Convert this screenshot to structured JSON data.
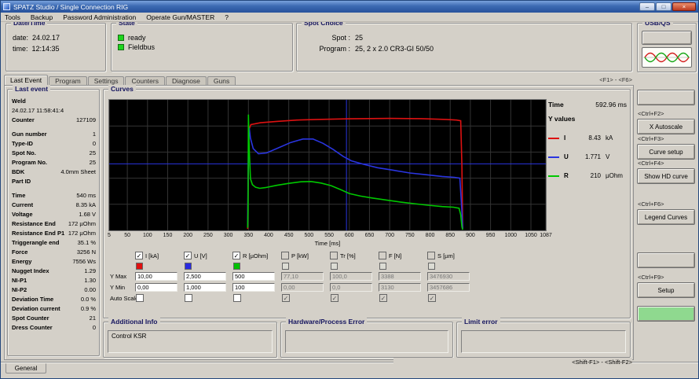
{
  "window": {
    "title": "SPATZ Studio / Single Connection RIG",
    "controls": {
      "minimize": "–",
      "maximize": "□",
      "close": "×"
    }
  },
  "menu": {
    "items": [
      "Tools",
      "Backup",
      "Password Administration",
      "Operate Gun/MASTER",
      "?"
    ]
  },
  "panels": {
    "datetime": {
      "title": "Date/Time",
      "date_label": "date:",
      "date_value": "24.02.17",
      "time_label": "time:",
      "time_value": "12:14:35"
    },
    "state": {
      "title": "State",
      "items": [
        "ready",
        "Fieldbus"
      ]
    },
    "spot": {
      "title": "Spot Choice",
      "spot_label": "Spot :",
      "spot_value": "25",
      "program_label": "Program :",
      "program_value": "25, 2 x 2.0 CR3-GI 50/50"
    },
    "usbqs": {
      "title": "USB/QS"
    }
  },
  "tabs": {
    "items": [
      "Last Event",
      "Program",
      "Settings",
      "Counters",
      "Diagnose",
      "Guns"
    ],
    "active": "Last Event",
    "hint": "<F1> - <F6>"
  },
  "last_event": {
    "title": "Last event",
    "rows": [
      {
        "l": "Weld",
        "v": ""
      },
      {
        "l": "24.02.17  11:58:41:4",
        "v": "",
        "p": true
      },
      {
        "l": "Counter",
        "v": "127109"
      },
      {
        "l": "",
        "v": ""
      },
      {
        "l": "Gun number",
        "v": "1"
      },
      {
        "l": "Type-ID",
        "v": "0"
      },
      {
        "l": "Spot No.",
        "v": "25"
      },
      {
        "l": "Program No.",
        "v": "25"
      },
      {
        "l": "BDK",
        "v": "4.0mm Sheet"
      },
      {
        "l": "Part ID",
        "v": ""
      },
      {
        "l": "",
        "v": ""
      },
      {
        "l": "Time",
        "v": "540 ms"
      },
      {
        "l": "Current",
        "v": "8.35 kA"
      },
      {
        "l": "Voltage",
        "v": "1.68 V"
      },
      {
        "l": "Resistance End",
        "v": "172 µOhm"
      },
      {
        "l": "Resistance End P1",
        "v": "172 µOhm"
      },
      {
        "l": "Triggerangle end",
        "v": "35.1 %"
      },
      {
        "l": "Force",
        "v": "3256 N"
      },
      {
        "l": "Energy",
        "v": "7556 Ws"
      },
      {
        "l": "Nugget Index",
        "v": "1.29"
      },
      {
        "l": "NI-P1",
        "v": "1.30"
      },
      {
        "l": "NI-P2",
        "v": "0.00"
      },
      {
        "l": "Deviation Time",
        "v": "0.0 %"
      },
      {
        "l": "Deviation current",
        "v": "0.9 %"
      },
      {
        "l": "Spot Counter",
        "v": "21"
      },
      {
        "l": "Dress Counter",
        "v": "0"
      }
    ]
  },
  "curves": {
    "title": "Curves",
    "legend": {
      "time_label": "Time",
      "time_value": "592.96 ms",
      "header": "Y values",
      "entries": [
        {
          "name": "I",
          "value": "8.43",
          "unit": "kA",
          "color": "#dd1111"
        },
        {
          "name": "U",
          "value": "1.771",
          "unit": "V",
          "color": "#2a35e0"
        },
        {
          "name": "R",
          "value": "210",
          "unit": "µOhm",
          "color": "#00c800"
        }
      ]
    },
    "row_labels": {
      "ymax": "Y Max",
      "ymin": "Y Min",
      "autoscale": "Auto Scale"
    },
    "channels": [
      {
        "label": "I [kA]",
        "checked": true,
        "enabled": true,
        "color": "#e01010",
        "ymax": "10,00",
        "ymin": "0,00",
        "autoscale": false
      },
      {
        "label": "U [V]",
        "checked": true,
        "enabled": true,
        "color": "#2a2ae0",
        "ymax": "2,500",
        "ymin": "1,000",
        "autoscale": false
      },
      {
        "label": "R [µOhm]",
        "checked": true,
        "enabled": true,
        "color": "#00c000",
        "ymax": "500",
        "ymin": "100",
        "autoscale": false
      },
      {
        "label": "P [kW]",
        "checked": false,
        "enabled": false,
        "color": "#dcdcd4",
        "ymax": "77,10",
        "ymin": "0,00",
        "autoscale": true
      },
      {
        "label": "Tr [%]",
        "checked": false,
        "enabled": false,
        "color": "#dcdcd4",
        "ymax": "100,0",
        "ymin": "0,0",
        "autoscale": true
      },
      {
        "label": "F [N]",
        "checked": false,
        "enabled": false,
        "color": "#dcdcd4",
        "ymax": "3388",
        "ymin": "3130",
        "autoscale": true
      },
      {
        "label": "S [µm]",
        "checked": false,
        "enabled": false,
        "color": "#dcdcd4",
        "ymax": "3476930",
        "ymin": "3457686",
        "autoscale": true
      }
    ]
  },
  "chart_data": {
    "type": "line",
    "title": "Curves",
    "xlabel": "Time [ms]",
    "x_range": [
      5,
      1087
    ],
    "x_ticks": [
      5,
      50,
      100,
      150,
      200,
      250,
      300,
      350,
      400,
      450,
      500,
      550,
      600,
      650,
      700,
      750,
      800,
      850,
      900,
      950,
      1000,
      1050,
      1087
    ],
    "cursor": {
      "x_ms": 592.96,
      "y_frac": 0.51
    },
    "series": [
      {
        "name": "I",
        "unit": "kA",
        "color": "#dd1111",
        "y_range": [
          0,
          10
        ],
        "points": [
          [
            348,
            0.1
          ],
          [
            351,
            7.7
          ],
          [
            356,
            8.1
          ],
          [
            380,
            8.25
          ],
          [
            420,
            8.35
          ],
          [
            470,
            8.45
          ],
          [
            520,
            8.5
          ],
          [
            600,
            8.55
          ],
          [
            700,
            8.58
          ],
          [
            780,
            8.56
          ],
          [
            840,
            8.5
          ],
          [
            866,
            8.45
          ],
          [
            876,
            8.4
          ],
          [
            879,
            5.0
          ],
          [
            881,
            0.15
          ]
        ]
      },
      {
        "name": "U",
        "unit": "V",
        "color": "#2a35e0",
        "y_range": [
          1.0,
          2.5
        ],
        "points": [
          [
            348,
            1.05
          ],
          [
            350,
            1.9
          ],
          [
            352,
            2.18
          ],
          [
            355,
            2.06
          ],
          [
            362,
            1.94
          ],
          [
            375,
            1.88
          ],
          [
            395,
            1.89
          ],
          [
            425,
            1.95
          ],
          [
            455,
            2.01
          ],
          [
            485,
            2.05
          ],
          [
            510,
            2.05
          ],
          [
            535,
            2.0
          ],
          [
            560,
            1.93
          ],
          [
            585,
            1.85
          ],
          [
            605,
            1.8
          ],
          [
            635,
            1.76
          ],
          [
            670,
            1.72
          ],
          [
            710,
            1.69
          ],
          [
            750,
            1.66
          ],
          [
            790,
            1.64
          ],
          [
            830,
            1.62
          ],
          [
            860,
            1.61
          ],
          [
            874,
            1.6
          ],
          [
            878,
            1.3
          ],
          [
            881,
            1.02
          ]
        ]
      },
      {
        "name": "R",
        "unit": "µOhm",
        "color": "#00c800",
        "y_range": [
          100,
          500
        ],
        "points": [
          [
            348,
            108
          ],
          [
            349,
            160
          ],
          [
            350,
            455
          ],
          [
            352,
            350
          ],
          [
            355,
            258
          ],
          [
            360,
            240
          ],
          [
            368,
            232
          ],
          [
            378,
            229
          ],
          [
            392,
            231
          ],
          [
            420,
            238
          ],
          [
            450,
            244
          ],
          [
            480,
            249
          ],
          [
            505,
            250
          ],
          [
            530,
            245
          ],
          [
            555,
            237
          ],
          [
            580,
            224
          ],
          [
            600,
            213
          ],
          [
            628,
            205
          ],
          [
            658,
            199
          ],
          [
            692,
            193
          ],
          [
            726,
            187
          ],
          [
            760,
            182
          ],
          [
            795,
            177
          ],
          [
            830,
            173
          ],
          [
            858,
            171
          ],
          [
            872,
            168
          ],
          [
            876,
            148
          ],
          [
            879,
            112
          ],
          [
            881,
            102
          ]
        ]
      }
    ]
  },
  "bottom_panels": {
    "additional": {
      "title": "Additional Info",
      "text": "Control KSR"
    },
    "hardware": {
      "title": "Hardware/Process Error",
      "text": ""
    },
    "limit": {
      "title": "Limit error",
      "text": ""
    }
  },
  "sidebar": {
    "items": [
      {
        "hotkey": "",
        "label": "",
        "variant": "plain"
      },
      {
        "hotkey": "<Ctrl+F2>",
        "label": "X Autoscale",
        "variant": "plain"
      },
      {
        "hotkey": "<Ctrl+F3>",
        "label": "Curve setup",
        "variant": "plain"
      },
      {
        "hotkey": "<Ctrl+F4>",
        "label": "Show HD curve",
        "variant": "plain"
      },
      {
        "hotkey": "<Ctrl+F6>",
        "label": "Legend Curves",
        "variant": "plain"
      },
      {
        "hotkey": "",
        "label": "",
        "variant": "plain"
      },
      {
        "hotkey": "<Ctrl+F9>",
        "label": "Setup",
        "variant": "plain"
      },
      {
        "hotkey": "",
        "label": "",
        "variant": "green"
      }
    ]
  },
  "statusbar": {
    "general_tab": "General",
    "hint": "<Shift-F1> - <Shift-F2>"
  },
  "icons": {
    "check": "✓"
  }
}
